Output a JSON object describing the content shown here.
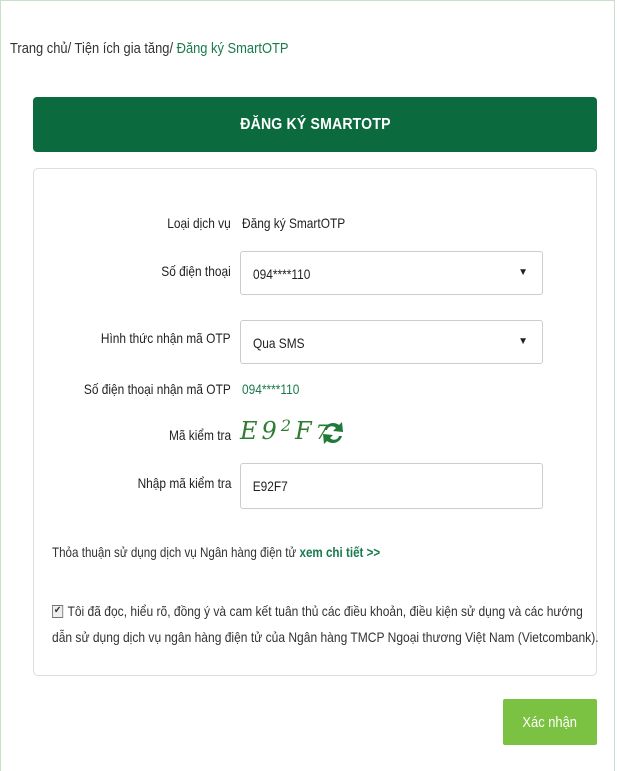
{
  "breadcrumb": {
    "home": "Trang chủ",
    "section": "Tiện ích gia tăng",
    "current": "Đăng ký SmartOTP",
    "separator": "/ "
  },
  "header": {
    "title": "ĐĂNG KÝ SMARTOTP"
  },
  "form": {
    "service_type": {
      "label": "Loại dịch vụ",
      "value": "Đăng ký SmartOTP"
    },
    "phone": {
      "label": "Số điện thoại",
      "selected": "094****110"
    },
    "otp_method": {
      "label": "Hình thức nhận mã OTP",
      "selected": "Qua SMS"
    },
    "otp_phone": {
      "label": "Số điện thoại nhận mã OTP",
      "value": "094****110"
    },
    "captcha": {
      "label": "Mã kiểm tra",
      "chars": [
        "E",
        "9",
        "2",
        "F",
        "7"
      ]
    },
    "captcha_input": {
      "label": "Nhập mã kiểm tra",
      "value": "E92F7"
    }
  },
  "terms": {
    "text": "Thỏa thuận sử dụng dịch vụ Ngân hàng điện tử",
    "link": "xem chi tiết >>"
  },
  "agreement": {
    "checked": true,
    "line1": "Tôi đã đọc, hiểu rõ, đồng ý và cam kết tuân thủ các điều khoản, điều kiện sử dụng và các hướng",
    "line2": "dẫn sử dụng dịch vụ ngân hàng điện tử của Ngân hàng TMCP Ngoại thương Việt Nam (Vietcombank)."
  },
  "submit_label": "Xác nhận",
  "colors": {
    "primary": "#0b6b3f",
    "accent": "#1a7a4f",
    "button": "#7cc242"
  }
}
